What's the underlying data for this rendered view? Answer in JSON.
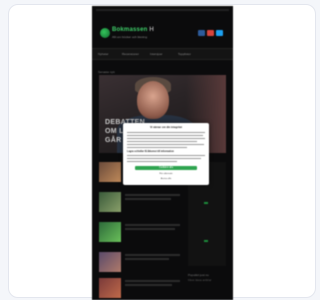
{
  "site": {
    "logo_name": "Bokmassen",
    "logo_suffix": "H",
    "tagline": "Allt om böcker och läsning"
  },
  "nav": {
    "items": [
      "Nyheter",
      "Recensioner",
      "Intervjuer",
      "Topplistor"
    ]
  },
  "main": {
    "section_label": "Senaste nytt",
    "hero": {
      "caption_lines": [
        "DEBATTEN",
        "OM LÄSNINGEN",
        "GÅR VIDARE"
      ]
    }
  },
  "sidebar": {
    "footer_label": "Populärt just nu",
    "footer_sub": "Mest lästa artiklar"
  },
  "consent": {
    "title": "Vi värnar om din integritet",
    "purpose_heading": "Lagra och/eller få åtkomst till information",
    "accept_label": "Godkänn alla",
    "more_options_label": "Fler alternativ",
    "reject_label": "Avvisa alla"
  },
  "colors": {
    "accent": "#2ea44f",
    "social": [
      "#2d5b9a",
      "#d6453d",
      "#1da1f2"
    ]
  }
}
